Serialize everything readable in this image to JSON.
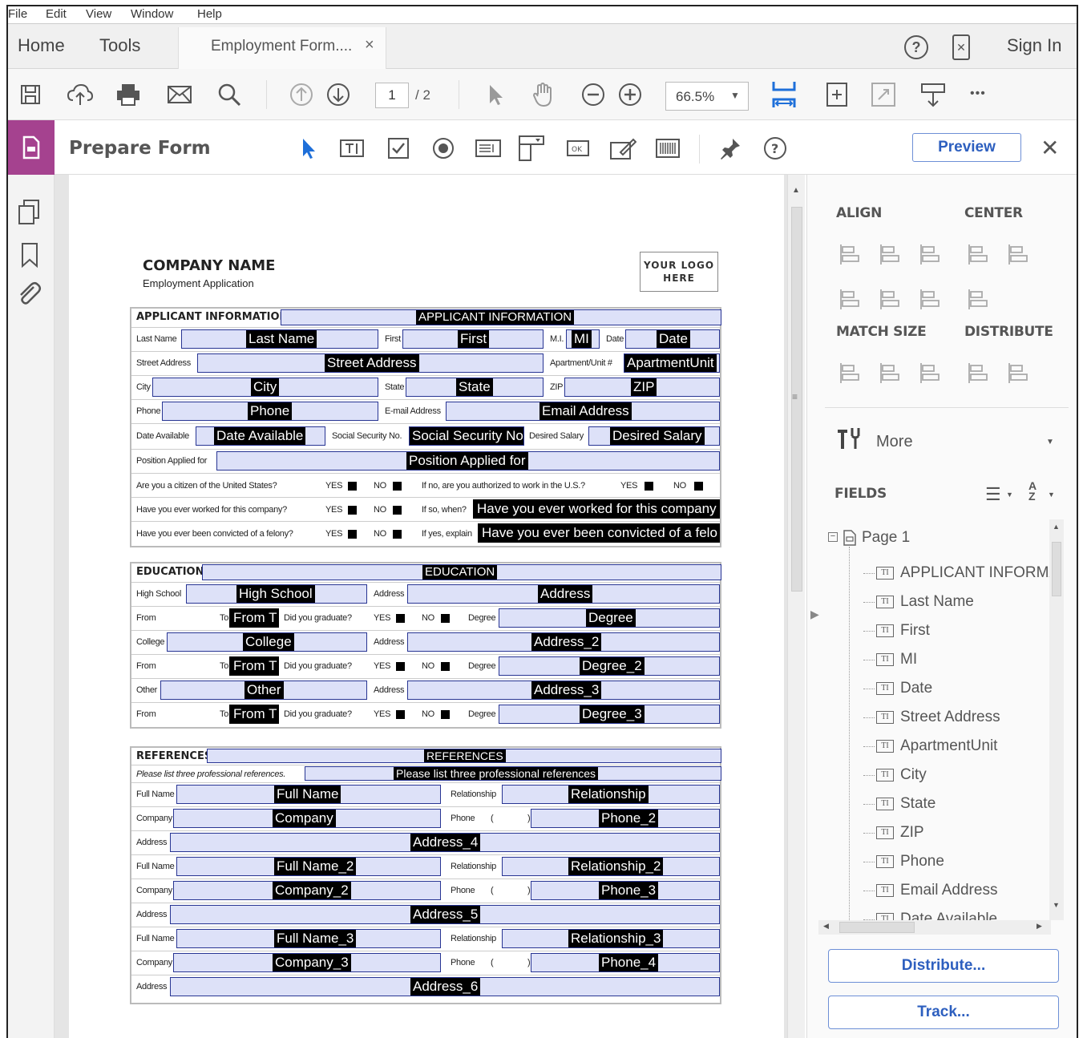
{
  "menu": [
    "File",
    "Edit",
    "View",
    "Window",
    "Help"
  ],
  "nav": {
    "home": "Home",
    "tools": "Tools",
    "doc_tab": "Employment Form....",
    "close": "×",
    "sign_in": "Sign In"
  },
  "toolbar": {
    "page_current": "1",
    "page_total": "/ 2",
    "zoom": "66.5%",
    "more": "•••"
  },
  "prepare": {
    "title": "Prepare Form",
    "preview": "Preview",
    "close": "✕"
  },
  "form": {
    "company": "COMPANY NAME",
    "subtitle": "Employment Application",
    "logo": "YOUR LOGO\nHERE",
    "applicant": {
      "header": "APPLICANT INFORMATION",
      "header_field": "APPLICANT INFORMATION",
      "last_name_lbl": "Last Name",
      "last_name": "Last Name",
      "first_lbl": "First",
      "first": "First",
      "mi_lbl": "M.I.",
      "mi": "MI",
      "date_lbl": "Date",
      "date": "Date",
      "street_lbl": "Street Address",
      "street": "Street Address",
      "apt_lbl": "Apartment/Unit #",
      "apt": "ApartmentUnit",
      "city_lbl": "City",
      "city": "City",
      "state_lbl": "State",
      "state": "State",
      "zip_lbl": "ZIP",
      "zip": "ZIP",
      "phone_lbl": "Phone",
      "phone": "Phone",
      "email_lbl": "E-mail Address",
      "email": "Email Address",
      "date_avail_lbl": "Date Available",
      "date_avail": "Date Available",
      "ssn_lbl": "Social Security No.",
      "ssn": "Social Security No",
      "salary_lbl": "Desired Salary",
      "salary": "Desired Salary",
      "position_lbl": "Position Applied for",
      "position": "Position Applied for",
      "citizen_q": "Are you a citizen of the United States?",
      "auth_q": "If no, are you authorized to work in the U.S.?",
      "worked_q": "Have you ever worked for this company?",
      "when_lbl": "If so, when?",
      "worked": "Have you ever worked for this company",
      "felony_q": "Have you ever been convicted of a felony?",
      "explain_lbl": "If yes, explain",
      "felony": "Have you ever been convicted of a felo",
      "yes": "YES",
      "no": "NO"
    },
    "education": {
      "header": "EDUCATION",
      "header_field": "EDUCATION",
      "high_school_lbl": "High School",
      "high_school": "High School",
      "address_lbl": "Address",
      "address": "Address",
      "address2": "Address_2",
      "address3": "Address_3",
      "from_lbl": "From",
      "to_lbl": "To",
      "from_to": "From T",
      "graduate_q": "Did you graduate?",
      "degree_lbl": "Degree",
      "degree": "Degree",
      "degree2": "Degree_2",
      "degree3": "Degree_3",
      "college_lbl": "College",
      "college": "College",
      "other_lbl": "Other",
      "other": "Other"
    },
    "references": {
      "header": "REFERENCES",
      "header_field": "REFERENCES",
      "note": "Please list three professional references.",
      "note_field": "Please list three professional references",
      "full_name_lbl": "Full Name",
      "relationship_lbl": "Relationship",
      "company_lbl": "Company",
      "phone_lbl": "Phone",
      "address_lbl": "Address",
      "paren_open": "(",
      "paren_close": ")",
      "refs": [
        {
          "name": "Full Name",
          "rel": "Relationship",
          "company": "Company",
          "phone": "Phone_2",
          "address": "Address_4"
        },
        {
          "name": "Full Name_2",
          "rel": "Relationship_2",
          "company": "Company_2",
          "phone": "Phone_3",
          "address": "Address_5"
        },
        {
          "name": "Full Name_3",
          "rel": "Relationship_3",
          "company": "Company_3",
          "phone": "Phone_4",
          "address": "Address_6"
        }
      ]
    }
  },
  "right_panel": {
    "align": "ALIGN",
    "center": "CENTER",
    "match_size": "MATCH SIZE",
    "distribute": "DISTRIBUTE",
    "more": "More",
    "fields": "FIELDS",
    "page": "Page 1",
    "fields_list": [
      "APPLICANT INFORMAT",
      "Last Name",
      "First",
      "MI",
      "Date",
      "Street Address",
      "ApartmentUnit",
      "City",
      "State",
      "ZIP",
      "Phone",
      "Email Address",
      "Date Available"
    ],
    "distribute_btn": "Distribute...",
    "track_btn": "Track..."
  }
}
